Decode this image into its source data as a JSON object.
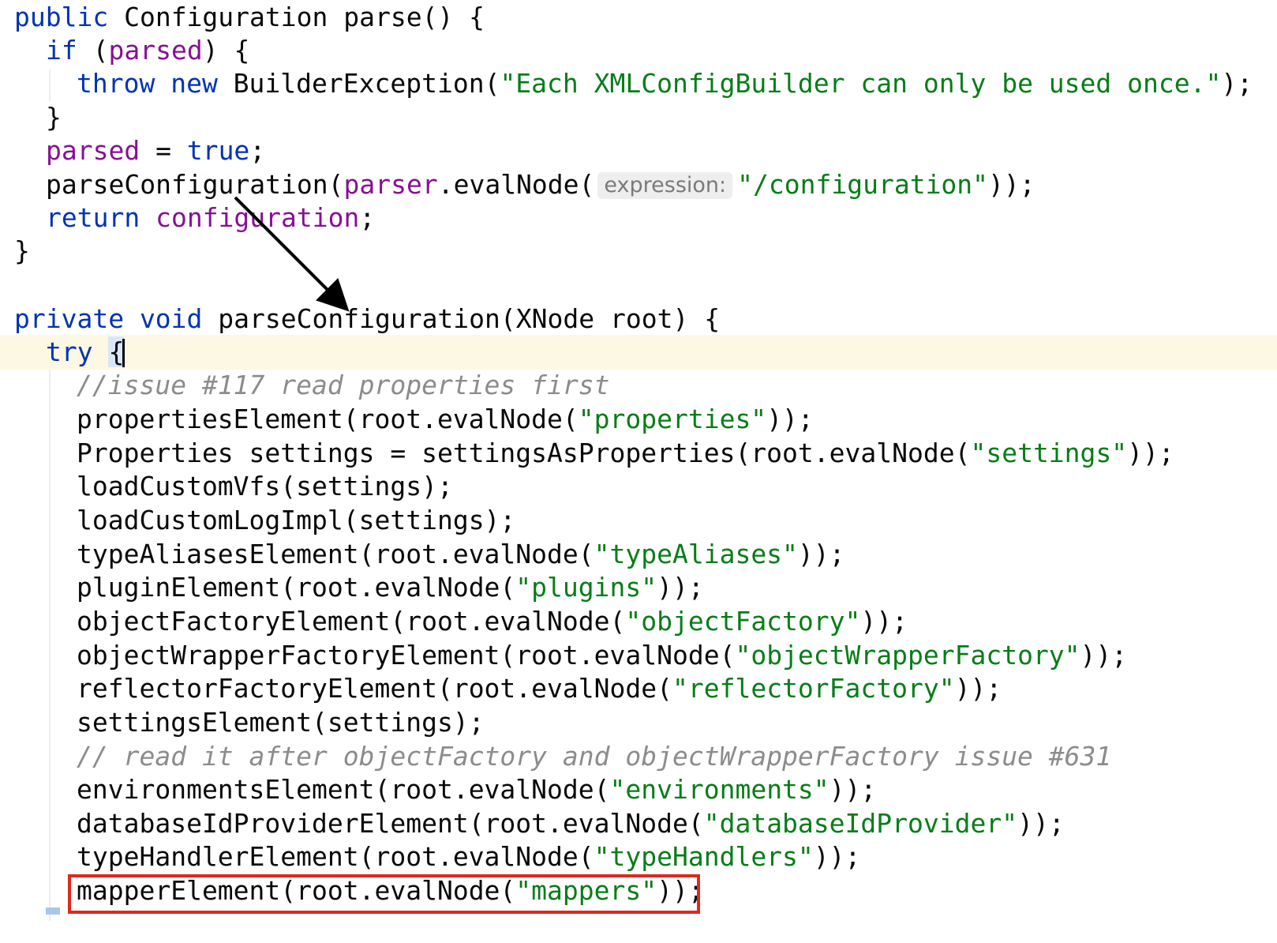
{
  "editor": {
    "language": "java",
    "lines": [
      {
        "tokens": [
          {
            "t": "kw",
            "s": "public"
          },
          {
            "t": "pl",
            "s": " Configuration parse() {"
          }
        ]
      },
      {
        "tokens": [
          {
            "t": "kw",
            "s": "if"
          },
          {
            "t": "pl",
            "s": " ("
          },
          {
            "t": "fld",
            "s": "parsed"
          },
          {
            "t": "pl",
            "s": ") {"
          }
        ]
      },
      {
        "tokens": [
          {
            "t": "kw",
            "s": "throw new"
          },
          {
            "t": "pl",
            "s": " BuilderException("
          },
          {
            "t": "str",
            "s": "\"Each XMLConfigBuilder can only be used once.\""
          },
          {
            "t": "pl",
            "s": ");"
          }
        ]
      },
      {
        "tokens": [
          {
            "t": "pl",
            "s": "}"
          }
        ]
      },
      {
        "tokens": [
          {
            "t": "fld",
            "s": "parsed"
          },
          {
            "t": "pl",
            "s": " = "
          },
          {
            "t": "kw",
            "s": "true"
          },
          {
            "t": "pl",
            "s": ";"
          }
        ]
      },
      {
        "tokens": [
          {
            "t": "pl",
            "s": "parseConfiguration("
          },
          {
            "t": "fld",
            "s": "parser"
          },
          {
            "t": "pl",
            "s": ".evalNode("
          },
          {
            "t": "hint",
            "s": "expression:"
          },
          {
            "t": "str",
            "s": "\"/configuration\""
          },
          {
            "t": "pl",
            "s": "));"
          }
        ]
      },
      {
        "tokens": [
          {
            "t": "kw",
            "s": "return"
          },
          {
            "t": "pl",
            "s": " "
          },
          {
            "t": "fld",
            "s": "configuration"
          },
          {
            "t": "pl",
            "s": ";"
          }
        ]
      },
      {
        "tokens": [
          {
            "t": "pl",
            "s": "}"
          }
        ]
      },
      {
        "tokens": [
          {
            "t": "kw",
            "s": "private void"
          },
          {
            "t": "pl",
            "s": " parseConfiguration(XNode root) {"
          }
        ]
      },
      {
        "tokens": [
          {
            "t": "kw",
            "s": "try"
          },
          {
            "t": "pl",
            "s": " "
          },
          {
            "t": "brace",
            "s": "{"
          }
        ]
      },
      {
        "tokens": [
          {
            "t": "cmt",
            "s": "//issue #117 read properties first"
          }
        ]
      },
      {
        "tokens": [
          {
            "t": "pl",
            "s": "propertiesElement(root.evalNode("
          },
          {
            "t": "str",
            "s": "\"properties\""
          },
          {
            "t": "pl",
            "s": "));"
          }
        ]
      },
      {
        "tokens": [
          {
            "t": "pl",
            "s": "Properties settings = settingsAsProperties(root.evalNode("
          },
          {
            "t": "str",
            "s": "\"settings\""
          },
          {
            "t": "pl",
            "s": "));"
          }
        ]
      },
      {
        "tokens": [
          {
            "t": "pl",
            "s": "loadCustomVfs(settings);"
          }
        ]
      },
      {
        "tokens": [
          {
            "t": "pl",
            "s": "loadCustomLogImpl(settings);"
          }
        ]
      },
      {
        "tokens": [
          {
            "t": "pl",
            "s": "typeAliasesElement(root.evalNode("
          },
          {
            "t": "str",
            "s": "\"typeAliases\""
          },
          {
            "t": "pl",
            "s": "));"
          }
        ]
      },
      {
        "tokens": [
          {
            "t": "pl",
            "s": "pluginElement(root.evalNode("
          },
          {
            "t": "str",
            "s": "\"plugins\""
          },
          {
            "t": "pl",
            "s": "));"
          }
        ]
      },
      {
        "tokens": [
          {
            "t": "pl",
            "s": "objectFactoryElement(root.evalNode("
          },
          {
            "t": "str",
            "s": "\"objectFactory\""
          },
          {
            "t": "pl",
            "s": "));"
          }
        ]
      },
      {
        "tokens": [
          {
            "t": "pl",
            "s": "objectWrapperFactoryElement(root.evalNode("
          },
          {
            "t": "str",
            "s": "\"objectWrapperFactory\""
          },
          {
            "t": "pl",
            "s": "));"
          }
        ]
      },
      {
        "tokens": [
          {
            "t": "pl",
            "s": "reflectorFactoryElement(root.evalNode("
          },
          {
            "t": "str",
            "s": "\"reflectorFactory\""
          },
          {
            "t": "pl",
            "s": "));"
          }
        ]
      },
      {
        "tokens": [
          {
            "t": "pl",
            "s": "settingsElement(settings);"
          }
        ]
      },
      {
        "tokens": [
          {
            "t": "cmt",
            "s": "// read it after objectFactory and objectWrapperFactory issue #631"
          }
        ]
      },
      {
        "tokens": [
          {
            "t": "pl",
            "s": "environmentsElement(root.evalNode("
          },
          {
            "t": "str",
            "s": "\"environments\""
          },
          {
            "t": "pl",
            "s": "));"
          }
        ]
      },
      {
        "tokens": [
          {
            "t": "pl",
            "s": "databaseIdProviderElement(root.evalNode("
          },
          {
            "t": "str",
            "s": "\"databaseIdProvider\""
          },
          {
            "t": "pl",
            "s": "));"
          }
        ]
      },
      {
        "tokens": [
          {
            "t": "pl",
            "s": "typeHandlerElement(root.evalNode("
          },
          {
            "t": "str",
            "s": "\"typeHandlers\""
          },
          {
            "t": "pl",
            "s": "));"
          }
        ]
      },
      {
        "tokens": [
          {
            "t": "pl",
            "s": "mapperElement(root.evalNode("
          },
          {
            "t": "str",
            "s": "\"mappers\""
          },
          {
            "t": "pl",
            "s": "));"
          }
        ]
      }
    ]
  },
  "colors": {
    "keyword": "#0033b3",
    "field": "#871094",
    "string": "#067d17",
    "comment": "#8c8c8c",
    "current_line": "#fdf8e3",
    "highlight_box": "#e0281e"
  },
  "annotations": {
    "arrow": {
      "from": "parseConfiguration call",
      "to": "parseConfiguration definition"
    },
    "highlight": "mapperElement call"
  }
}
